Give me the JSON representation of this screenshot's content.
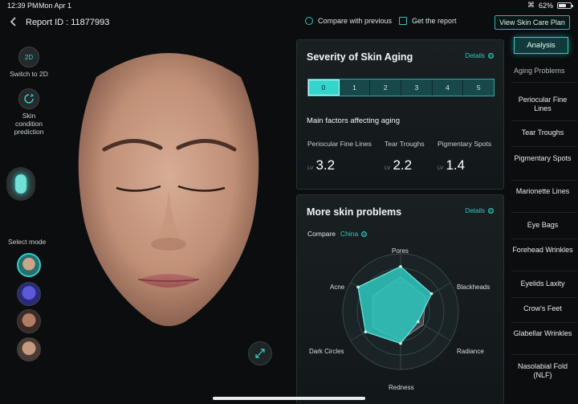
{
  "status_bar": {
    "time": "12:39 PM",
    "date": "Mon Apr 1",
    "battery": "62%"
  },
  "header": {
    "back_icon": "chevron-left-icon",
    "report_id": "Report ID : 11877993",
    "compare_label": "Compare with previous",
    "report_label": "Get the report",
    "skin_care_plan": "View Skin Care Plan"
  },
  "left_tools": {
    "switch_2d_badge": "2D",
    "switch_2d_label": "Switch to 2D",
    "prediction_label": "Skin condition prediction",
    "select_mode": "Select mode"
  },
  "severity_panel": {
    "title": "Severity of Skin Aging",
    "details": "Details",
    "levels": [
      "0",
      "1",
      "2",
      "3",
      "4",
      "5"
    ],
    "active_level": 0,
    "factors_title": "Main factors affecting aging",
    "factors": [
      {
        "name": "Periocular Fine Lines",
        "lv": "LV",
        "value": "3.2"
      },
      {
        "name": "Tear Troughs",
        "lv": "LV",
        "value": "2.2"
      },
      {
        "name": "Pigmentary Spots",
        "lv": "LV",
        "value": "1.4"
      }
    ]
  },
  "problems_panel": {
    "title": "More skin problems",
    "details": "Details",
    "compare_label": "Compare",
    "compare_value": "China",
    "radar_axes": [
      "Pores",
      "Blackheads",
      "Radiance",
      "Redness",
      "Dark Circles",
      "Acne"
    ],
    "user_values": [
      0.78,
      0.62,
      0.35,
      0.55,
      0.7,
      0.85
    ],
    "reference_values": [
      0.6,
      0.5,
      0.45,
      0.5,
      0.55,
      0.55
    ],
    "accent": "#2fc9c1"
  },
  "right_nav": {
    "analysis": "Analysis",
    "aging_problems": "Aging Problems",
    "items": [
      "Periocular Fine Lines",
      "Tear Troughs",
      "Pigmentary Spots",
      "Marionette Lines",
      "Eye Bags",
      "Forehead Wrinkles",
      "Eyelids Laxity",
      "Crow's Feet",
      "Glabellar Wrinkles",
      "Nasolabial Fold (NLF)"
    ]
  }
}
